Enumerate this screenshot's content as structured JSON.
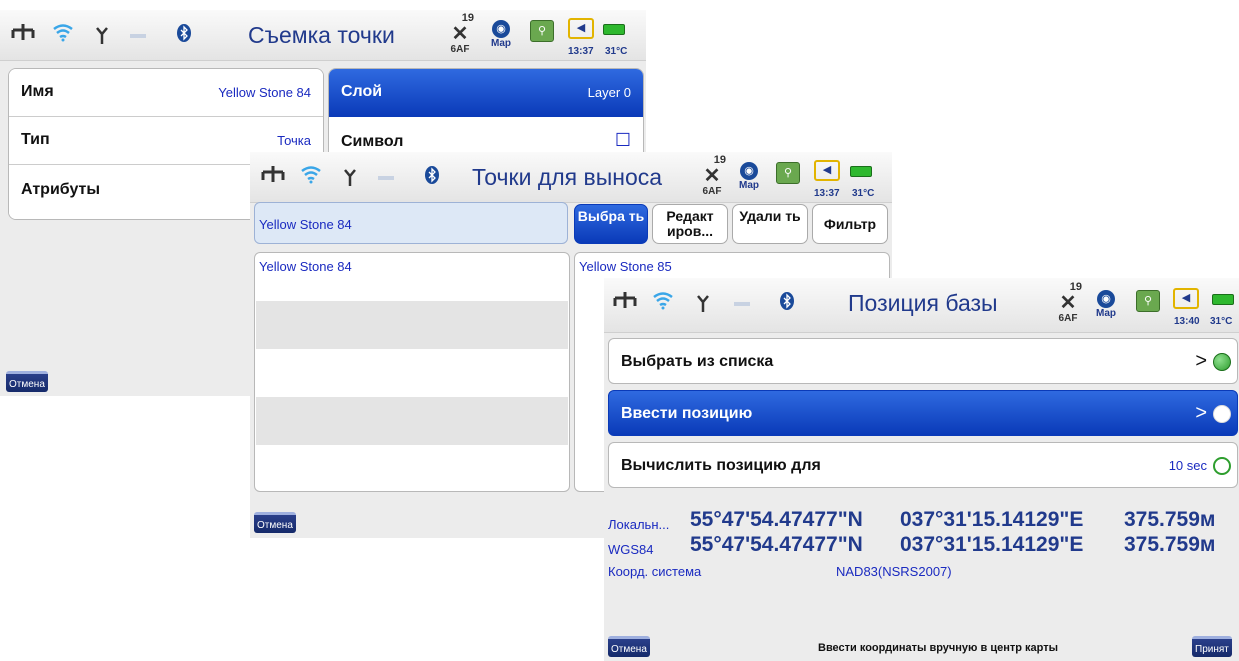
{
  "status": {
    "sat_count": "19",
    "sat_sub": "6AF",
    "map_label": "Map",
    "temp": "31°C",
    "time1": "13:37",
    "time3": "13:40"
  },
  "screen1": {
    "title": "Съемка точки",
    "rows": [
      {
        "label": "Имя",
        "value": "Yellow Stone 84"
      },
      {
        "label": "Тип",
        "value": "Точка"
      },
      {
        "label": "Атрибуты",
        "value": ""
      }
    ],
    "right_rows": [
      {
        "label": "Слой",
        "value": "Layer 0"
      },
      {
        "label": "Символ",
        "value": "☐"
      }
    ],
    "cancel": "Отмена"
  },
  "screen2": {
    "title": "Точки для выноса",
    "search_value": "Yellow Stone 84",
    "buttons": [
      "Выбра ть",
      "Редакт иров...",
      "Удали ть",
      "Фильтр"
    ],
    "left_item": "Yellow Stone 84",
    "right_item": "Yellow Stone 85",
    "cancel": "Отмена"
  },
  "screen3": {
    "title": "Позиция базы",
    "options": [
      {
        "label": "Выбрать из списка",
        "value": ">"
      },
      {
        "label": "Ввести позицию",
        "value": ">"
      },
      {
        "label": "Вычислить позицию для",
        "value": "10 sec"
      }
    ],
    "coords": [
      {
        "label": "Локальн...",
        "lat": "55°47'54.47477\"N",
        "lon": "037°31'15.14129\"E",
        "h": "375.759м"
      },
      {
        "label": "WGS84",
        "lat": "55°47'54.47477\"N",
        "lon": "037°31'15.14129\"E",
        "h": "375.759м"
      }
    ],
    "coord_sys_label": "Коорд. система",
    "coord_sys_value": "NAD83(NSRS2007)",
    "hint": "Ввести координаты вручную в центр карты",
    "cancel": "Отмена",
    "accept": "Принят"
  },
  "colors": {
    "accent": "#0a3ab8",
    "title": "#213a8c",
    "green": "#2eb82e"
  }
}
